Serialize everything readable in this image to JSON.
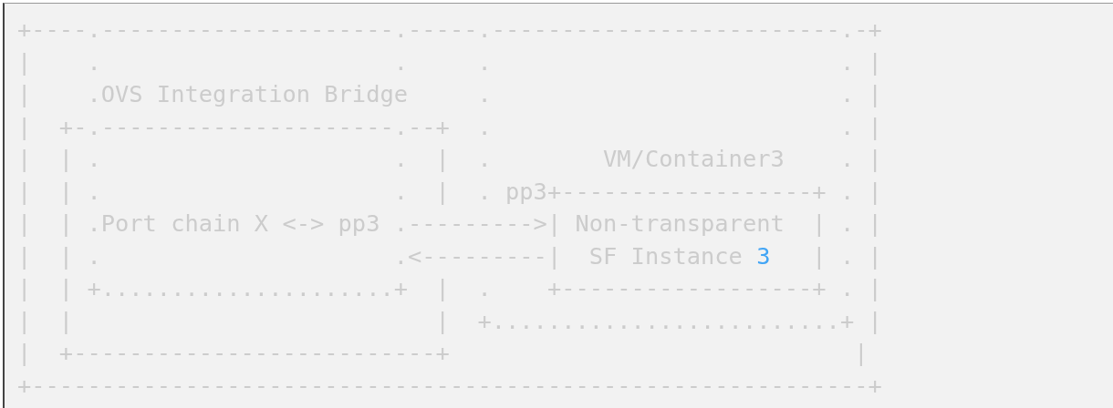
{
  "code_block": {
    "lines": [
      {
        "parts": [
          {
            "kind": "plain",
            "text": "+----.---------------------.-----.-------------------------.-+"
          }
        ]
      },
      {
        "parts": [
          {
            "kind": "plain",
            "text": "|    .                     .     .                         . |"
          }
        ]
      },
      {
        "parts": [
          {
            "kind": "plain",
            "text": "|    .OVS Integration Bridge     .                         . |"
          }
        ]
      },
      {
        "parts": [
          {
            "kind": "plain",
            "text": "|  +-.---------------------.--+  .                         . |"
          }
        ]
      },
      {
        "parts": [
          {
            "kind": "plain",
            "text": "|  | .                     .  |  .        VM/Container3    . |"
          }
        ]
      },
      {
        "parts": [
          {
            "kind": "plain",
            "text": "|  | .                     .  |  . pp3+------------------+ . |"
          }
        ]
      },
      {
        "parts": [
          {
            "kind": "plain",
            "text": "|  | .Port chain X <-> pp3 .--------->| Non-transparent  | . |"
          }
        ]
      },
      {
        "parts": [
          {
            "kind": "plain",
            "text": "|  | .                     .<---------|  SF Instance "
          },
          {
            "kind": "number",
            "text": "3"
          },
          {
            "kind": "plain",
            "text": "   | . |"
          }
        ]
      },
      {
        "parts": [
          {
            "kind": "plain",
            "text": "|  | +.....................+  |  .    +------------------+ . |"
          }
        ]
      },
      {
        "parts": [
          {
            "kind": "plain",
            "text": "|  |                          |  +.........................+ |"
          }
        ]
      },
      {
        "parts": [
          {
            "kind": "plain",
            "text": "|  +--------------------------+                             |"
          }
        ]
      },
      {
        "parts": [
          {
            "kind": "plain",
            "text": "+------------------------------------------------------------+"
          }
        ]
      }
    ]
  }
}
